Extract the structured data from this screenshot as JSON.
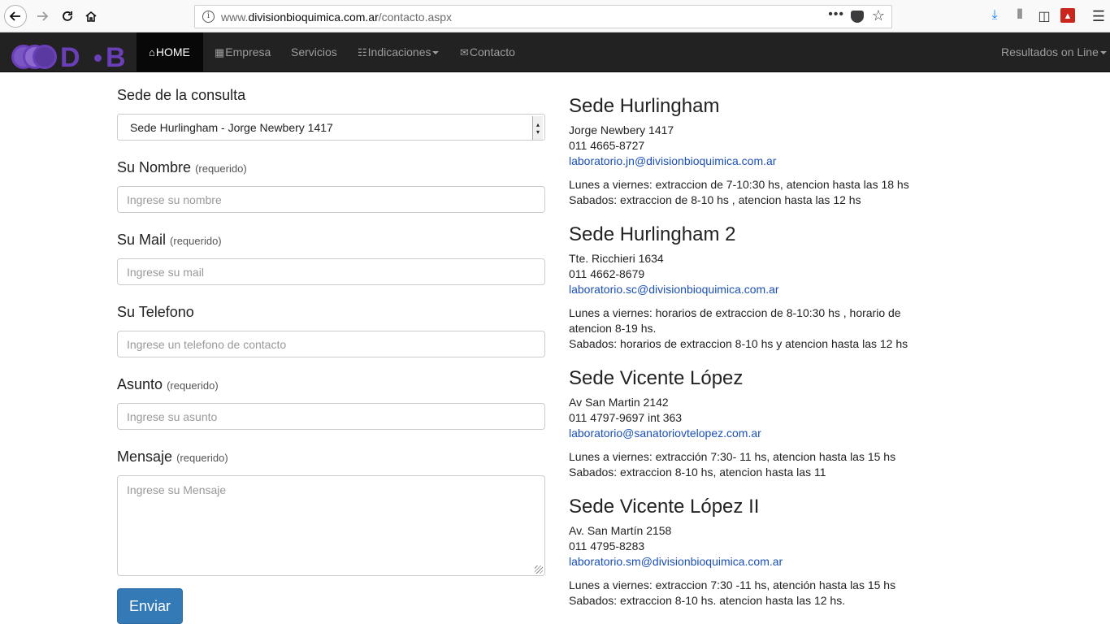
{
  "browser": {
    "url_prefix": "www.",
    "url_host": "divisionbioquimica.com.ar",
    "url_path": "/contacto.aspx",
    "icons": [
      "back-icon",
      "forward-icon",
      "reload-icon",
      "home-icon",
      "info-icon",
      "more-dots-icon",
      "pocket-icon",
      "star-icon",
      "download-icon",
      "library-icon",
      "sidebar-icon",
      "pdf-icon",
      "menu-icon"
    ]
  },
  "navbar": {
    "logo_letters": [
      "D",
      "B"
    ],
    "items": [
      {
        "label": "HOME",
        "icon": "home-icon",
        "active": true
      },
      {
        "label": "Empresa",
        "icon": "briefcase-icon"
      },
      {
        "label": "Servicios"
      },
      {
        "label": "Indicaciones",
        "icon": "list-icon",
        "dropdown": true
      },
      {
        "label": "Contacto",
        "icon": "envelope-icon"
      }
    ],
    "right_item": {
      "label": "Resultados on Line",
      "dropdown": true
    }
  },
  "form": {
    "sede_label": "Sede de la consulta",
    "sede_selected": "Sede Hurlingham - Jorge Newbery 1417",
    "nombre_label": "Su Nombre",
    "nombre_req": "(requerido)",
    "nombre_placeholder": "Ingrese su nombre",
    "mail_label": "Su Mail",
    "mail_req": "(requerido)",
    "mail_placeholder": "Ingrese su mail",
    "telefono_label": "Su Telefono",
    "telefono_placeholder": "Ingrese un telefono de contacto",
    "asunto_label": "Asunto",
    "asunto_req": "(requerido)",
    "asunto_placeholder": "Ingrese su asunto",
    "mensaje_label": "Mensaje",
    "mensaje_req": "(requerido)",
    "mensaje_placeholder": "Ingrese su Mensaje",
    "submit_label": "Enviar"
  },
  "locations": [
    {
      "title": "Sede Hurlingham",
      "address": "Jorge Newbery 1417",
      "phone": "011 4665-8727",
      "email": "laboratorio.jn@divisionbioquimica.com.ar",
      "hours": [
        "Lunes a viernes: extraccion de 7-10:30 hs, atencion hasta las 18 hs",
        "Sabados: extraccion de 8-10 hs , atencion hasta las 12 hs"
      ]
    },
    {
      "title": "Sede Hurlingham 2",
      "address": "Tte. Ricchieri 1634",
      "phone": "011 4662-8679",
      "email": "laboratorio.sc@divisionbioquimica.com.ar",
      "hours": [
        "Lunes a viernes: horarios de extraccion de 8-10:30 hs , horario de",
        "atencion 8-19 hs.",
        "Sabados: horarios de extraccion 8-10 hs y atencion hasta las 12 hs"
      ]
    },
    {
      "title": "Sede Vicente López",
      "address": "Av San Martin 2142",
      "phone": "011 4797-9697 int 363",
      "email": "laboratorio@sanatoriovtelopez.com.ar",
      "hours": [
        "Lunes a viernes: extracción 7:30- 11 hs, atencion hasta las 15 hs",
        "Sabados: extraccion 8-10 hs, atencion hasta las 11"
      ]
    },
    {
      "title": "Sede Vicente López II",
      "address": "Av. San Martín 2158",
      "phone": "011 4795-8283",
      "email": "laboratorio.sm@divisionbioquimica.com.ar",
      "hours": [
        "Lunes a viernes: extraccion 7:30 -11 hs, atención hasta las 15 hs",
        "Sabados: extraccion 8-10 hs. atencion hasta las 12 hs."
      ]
    }
  ]
}
